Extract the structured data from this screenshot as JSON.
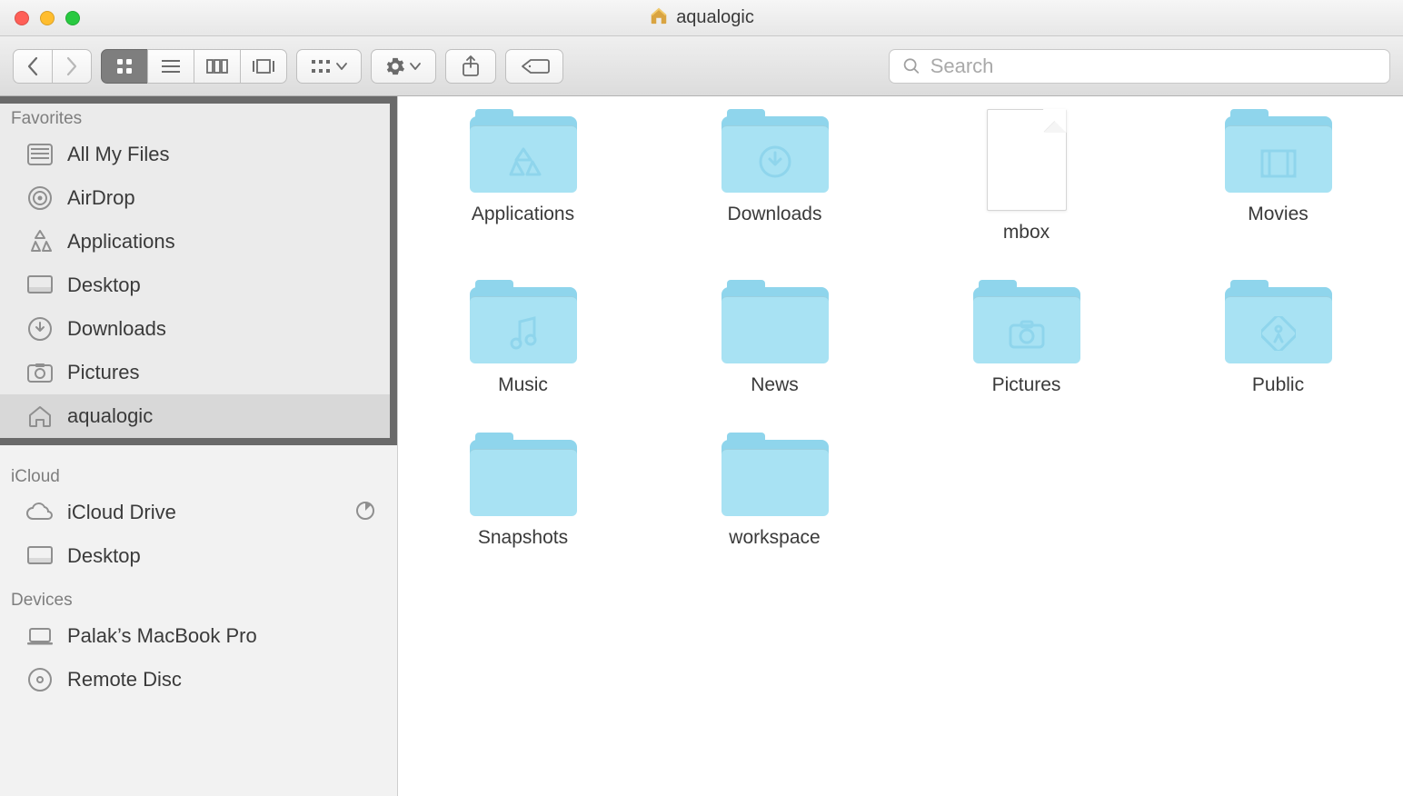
{
  "window": {
    "title": "aqualogic"
  },
  "search": {
    "placeholder": "Search"
  },
  "sidebar": {
    "sections": {
      "favorites": {
        "title": "Favorites",
        "items": [
          {
            "label": "All My Files"
          },
          {
            "label": "AirDrop"
          },
          {
            "label": "Applications"
          },
          {
            "label": "Desktop"
          },
          {
            "label": "Downloads"
          },
          {
            "label": "Pictures"
          },
          {
            "label": "aqualogic"
          }
        ]
      },
      "icloud": {
        "title": "iCloud",
        "items": [
          {
            "label": "iCloud Drive"
          },
          {
            "label": "Desktop"
          }
        ]
      },
      "devices": {
        "title": "Devices",
        "items": [
          {
            "label": "Palak’s MacBook Pro"
          },
          {
            "label": "Remote Disc"
          }
        ]
      }
    }
  },
  "items": [
    {
      "label": "Applications",
      "type": "folder",
      "glyph": "apps"
    },
    {
      "label": "Downloads",
      "type": "folder",
      "glyph": "download"
    },
    {
      "label": "mbox",
      "type": "file"
    },
    {
      "label": "Movies",
      "type": "folder",
      "glyph": "movies"
    },
    {
      "label": "Music",
      "type": "folder",
      "glyph": "music"
    },
    {
      "label": "News",
      "type": "folder",
      "glyph": ""
    },
    {
      "label": "Pictures",
      "type": "folder",
      "glyph": "pictures"
    },
    {
      "label": "Public",
      "type": "folder",
      "glyph": "public"
    },
    {
      "label": "Snapshots",
      "type": "folder",
      "glyph": ""
    },
    {
      "label": "workspace",
      "type": "folder",
      "glyph": ""
    }
  ]
}
